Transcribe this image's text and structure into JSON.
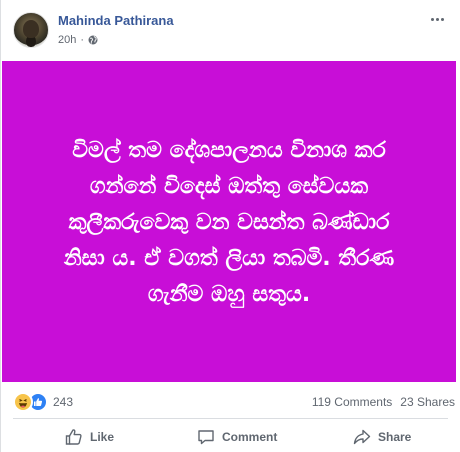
{
  "post": {
    "author": "Mahinda Pathirana",
    "time": "20h",
    "privacy_icon": "globe-icon",
    "background_color": "#c80ed7",
    "text_lines": [
      "විමල් තම දේශපාලනය විනාශ කර",
      "ගන්නේ විදෙස් ඔත්තු සේවයක",
      "කුලීකරුවෙකු වන වසන්ත බණ්ඩාර",
      "නිසා ය. ඒ වගත් ලියා තබමි. තීරණ",
      "ගැනීම ඔහු සතුය."
    ]
  },
  "stats": {
    "reaction_icons": [
      "haha-icon",
      "like-icon"
    ],
    "reaction_count": "243",
    "comments": "119 Comments",
    "shares": "23 Shares"
  },
  "actions": {
    "like": "Like",
    "comment": "Comment",
    "share": "Share"
  },
  "colors": {
    "author_link": "#385898",
    "muted": "#606770"
  }
}
